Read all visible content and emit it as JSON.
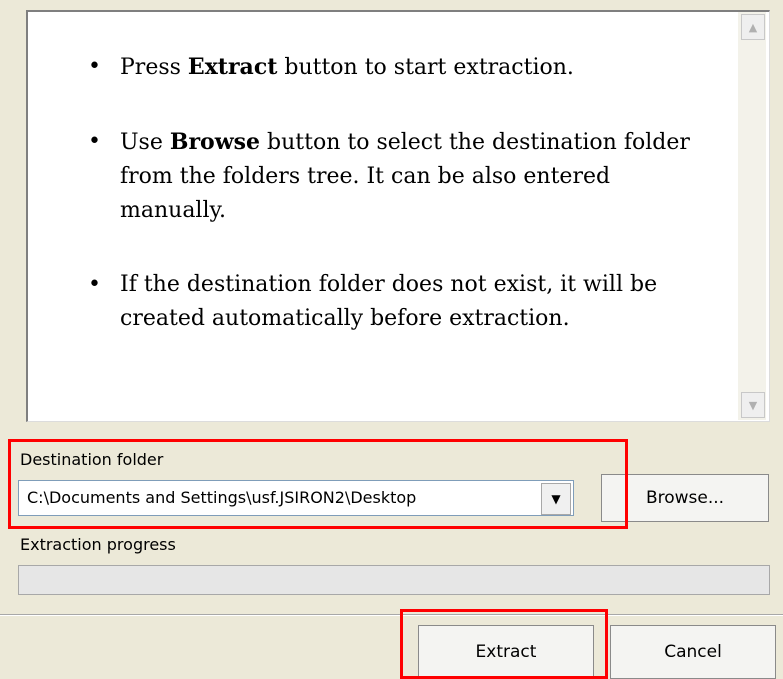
{
  "info": {
    "bullet1": {
      "pre": "Press ",
      "bold": "Extract",
      "post": " button to start extraction."
    },
    "bullet2": {
      "pre": "Use ",
      "bold": "Browse",
      "post": " button to select the destination folder from the folders tree. It can be also entered manually."
    },
    "bullet3": {
      "text": "If the destination folder does not exist, it will be created automatically before extraction."
    }
  },
  "destination": {
    "label": "Destination folder",
    "value": "C:\\Documents and Settings\\usf.JSIRON2\\Desktop",
    "browse_label": "Browse..."
  },
  "progress": {
    "label": "Extraction progress",
    "value": 0
  },
  "buttons": {
    "extract_label": "Extract",
    "cancel_label": "Cancel"
  },
  "icons": {
    "scroll_up": "scroll-up-arrow-icon",
    "scroll_down": "scroll-down-arrow-icon",
    "dropdown": "chevron-down-icon"
  },
  "colors": {
    "highlight": "#ff0000",
    "dialog_bg": "#ece9d8"
  }
}
